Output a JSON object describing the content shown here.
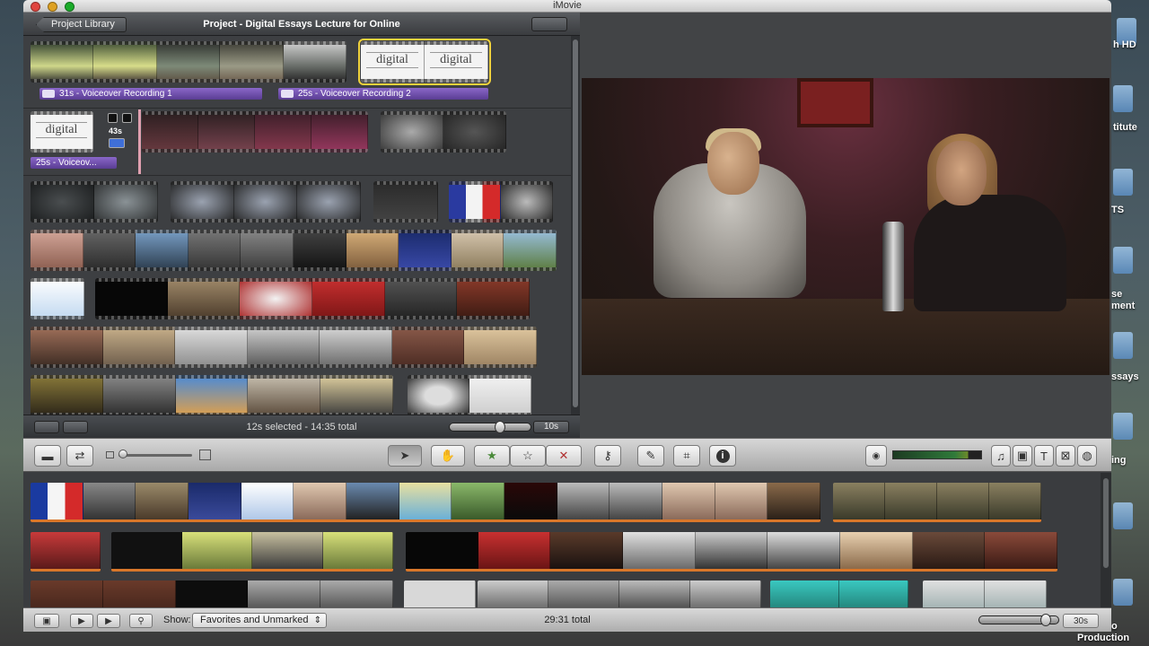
{
  "app": {
    "title": "iMovie"
  },
  "desktop": {
    "labels": [
      "h HD",
      "titute",
      "TS",
      "se",
      "ment",
      "ssays",
      "ing",
      "o",
      "Production"
    ]
  },
  "project": {
    "back_label": "Project Library",
    "title": "Project - Digital Essays Lecture for Online",
    "voiceovers": [
      "31s - Voiceover Recording 1",
      "25s - Voiceover Recording 2",
      "25s - Voiceov..."
    ],
    "clip_badge": "43s",
    "title_card_text": "digital",
    "footer_status": "12s selected - 14:35 total",
    "zoom_label": "10s"
  },
  "toolbar": {
    "icons": [
      "camera-icon",
      "swap-icon",
      "clip-size-small-icon",
      "clip-size-large-icon",
      "arrow-icon",
      "hand-icon",
      "star-filled-icon",
      "star-empty-icon",
      "reject-icon",
      "key-icon",
      "dropper-icon",
      "crop-icon",
      "info-icon",
      "audio-icon",
      "music-icon",
      "photo-icon",
      "title-icon",
      "transition-icon",
      "map-icon"
    ],
    "star_filled": "★",
    "star_empty": "☆",
    "reject": "✕",
    "info": "i",
    "music": "♫",
    "title": "T"
  },
  "events": {
    "show_label": "Show:",
    "filter_value": "Favorites and Unmarked",
    "total": "29:31 total",
    "zoom_label": "30s"
  },
  "colors": {
    "accent_selected": "#f0d23c",
    "voiceover": "#6e4fb0",
    "event_bar": "#d9772a"
  }
}
